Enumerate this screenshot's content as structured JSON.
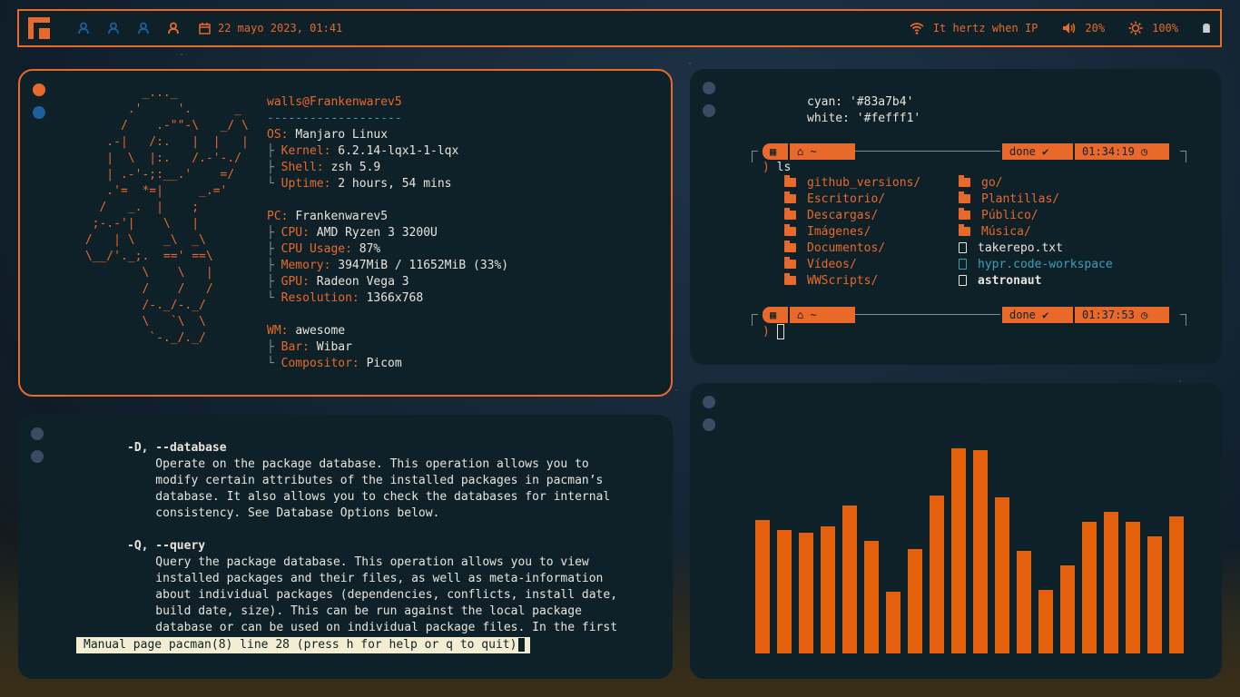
{
  "topbar": {
    "tags": [
      {
        "icon": "user-icon",
        "color": "#1e5f99"
      },
      {
        "icon": "user-icon",
        "color": "#1e5f99"
      },
      {
        "icon": "user-icon",
        "color": "#1e5f99"
      },
      {
        "icon": "user-icon",
        "color": "#e8692a"
      }
    ],
    "datetime": "22 mayo 2023, 01:41",
    "wifi": "It hertz when IP",
    "volume": "20%",
    "brightness": "100%"
  },
  "fetch": {
    "ascii": "         _..._\n       .'     '.      _\n      /    .-\"\"-\\   _/ \\\n    .-|   /:.   |  |   |\n    |  \\  |:.   /.-'-./\n    | .-'-;:__.'    =/\n    .'=  *=|     _.='\n   /   _.  |    ;\n  ;-.-'|    \\   |\n /   | \\    _\\  _\\\n \\__/'._;.  ==' ==\\\n         \\    \\   |\n         /    /   /\n         /-._/-._/\n         \\   `\\  \\\n          `-._/._/",
    "user": "walls@Frankenwarev5",
    "separator": "-------------------",
    "os_key": "OS:",
    "os_val": "Manjaro Linux",
    "kernel_key": "Kernel:",
    "kernel_val": "6.2.14-lqx1-1-lqx",
    "shell_key": "Shell:",
    "shell_val": "zsh 5.9",
    "uptime_key": "Uptime:",
    "uptime_val": "2 hours, 54 mins",
    "pc_key": "PC:",
    "pc_val": "Frankenwarev5",
    "cpu_key": "CPU:",
    "cpu_val": "AMD Ryzen 3 3200U",
    "cpuusage_key": "CPU Usage:",
    "cpuusage_val": "87%",
    "memory_key": "Memory:",
    "memory_val": "3947MiB / 11652MiB (33%)",
    "gpu_key": "GPU:",
    "gpu_val": "Radeon Vega 3",
    "res_key": "Resolution:",
    "res_val": "1366x768",
    "wm_key": "WM:",
    "wm_val": "awesome",
    "bar_key": "Bar:",
    "bar_val": "Wibar",
    "comp_key": "Compositor:",
    "comp_val": "Picom"
  },
  "terminal": {
    "cyan_line": "cyan: '#83a7b4'",
    "white_line": "white: '#fefff1'",
    "prompt1": {
      "home": "~",
      "status": "done ✔",
      "time": "01:34:19"
    },
    "command": "ls",
    "files_col1": [
      {
        "name": "github_versions/",
        "type": "dir"
      },
      {
        "name": "Escritorio/",
        "type": "dir"
      },
      {
        "name": "Descargas/",
        "type": "dir"
      },
      {
        "name": "Imágenes/",
        "type": "dir"
      },
      {
        "name": "Documentos/",
        "type": "dir"
      },
      {
        "name": "Vídeos/",
        "type": "dir"
      },
      {
        "name": "WWScripts/",
        "type": "dir"
      }
    ],
    "files_col2": [
      {
        "name": "go/",
        "type": "dir"
      },
      {
        "name": "Plantillas/",
        "type": "dir"
      },
      {
        "name": "Público/",
        "type": "dir"
      },
      {
        "name": "Música/",
        "type": "dir"
      },
      {
        "name": "takerepo.txt",
        "type": "file"
      },
      {
        "name": "hypr.code-workspace",
        "type": "code"
      },
      {
        "name": "astronaut",
        "type": "bold"
      }
    ],
    "prompt2": {
      "home": "~",
      "status": "done ✔",
      "time": "01:37:53"
    },
    "prompt_char": ")"
  },
  "man": {
    "lines": [
      {
        "t": "-D, --database",
        "h": true
      },
      {
        "t": "    Operate on the package database. This operation allows you to",
        "h": false
      },
      {
        "t": "    modify certain attributes of the installed packages in pacman’s",
        "h": false
      },
      {
        "t": "    database. It also allows you to check the databases for internal",
        "h": false
      },
      {
        "t": "    consistency. See Database Options below.",
        "h": false
      },
      {
        "t": "",
        "h": false
      },
      {
        "t": "-Q, --query",
        "h": true
      },
      {
        "t": "    Query the package database. This operation allows you to view",
        "h": false
      },
      {
        "t": "    installed packages and their files, as well as meta-information",
        "h": false
      },
      {
        "t": "    about individual packages (dependencies, conflicts, install date,",
        "h": false
      },
      {
        "t": "    build date, size). This can be run against the local package",
        "h": false
      },
      {
        "t": "    database or can be used on individual package files. In the first",
        "h": false
      }
    ],
    "status": "Manual page pacman(8) line 28 (press h for help or q to quit)"
  },
  "visualizer": {
    "color": "#e4600c",
    "levels": [
      0.65,
      0.6,
      0.59,
      0.62,
      0.72,
      0.55,
      0.3,
      0.51,
      0.77,
      1.0,
      0.99,
      0.76,
      0.5,
      0.31,
      0.43,
      0.64,
      0.69,
      0.64,
      0.57,
      0.67
    ]
  }
}
